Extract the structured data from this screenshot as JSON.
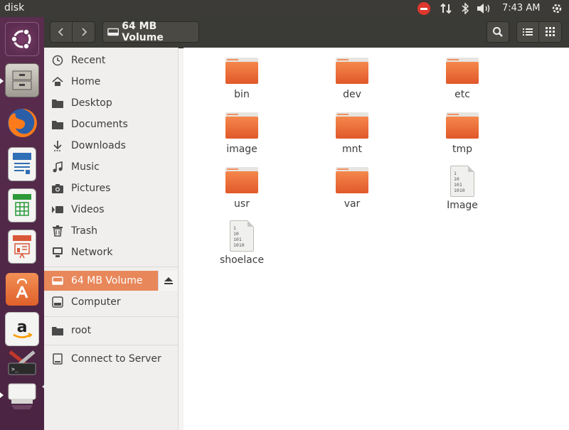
{
  "topbar": {
    "app_title": "disk",
    "clock": "7:43 AM"
  },
  "launcher": {
    "items": [
      {
        "icon": "ubuntu-dash-icon",
        "color": "#e95420"
      },
      {
        "icon": "file-cabinet-icon",
        "color": "#b9b6ae"
      },
      {
        "icon": "firefox-icon",
        "color": "#ff7a1a"
      },
      {
        "icon": "writer-document-icon",
        "color": "#2f6fb5"
      },
      {
        "icon": "calc-spreadsheet-icon",
        "color": "#2c9a3a"
      },
      {
        "icon": "impress-presentation-icon",
        "color": "#d9583a"
      },
      {
        "icon": "software-center-icon",
        "color": "#ef7634"
      },
      {
        "icon": "amazon-icon",
        "color": "#232f3e"
      },
      {
        "icon": "system-tools-icon",
        "color": "#c0c0c0"
      },
      {
        "icon": "removable-drive-icon",
        "color": "#e2e2e0"
      }
    ]
  },
  "headerbar": {
    "path_label": "64 MB Volume"
  },
  "sidebar": {
    "items": [
      {
        "label": "Recent",
        "icon": "clock-icon"
      },
      {
        "label": "Home",
        "icon": "home-icon"
      },
      {
        "label": "Desktop",
        "icon": "folder-icon"
      },
      {
        "label": "Documents",
        "icon": "folder-icon"
      },
      {
        "label": "Downloads",
        "icon": "download-icon"
      },
      {
        "label": "Music",
        "icon": "music-icon"
      },
      {
        "label": "Pictures",
        "icon": "camera-icon"
      },
      {
        "label": "Videos",
        "icon": "video-icon"
      },
      {
        "label": "Trash",
        "icon": "trash-icon"
      },
      {
        "label": "Network",
        "icon": "network-icon"
      }
    ],
    "devices": [
      {
        "label": "64 MB Volume",
        "icon": "drive-icon",
        "active": true
      },
      {
        "label": "Computer",
        "icon": "computer-icon"
      }
    ],
    "bookmarks": [
      {
        "label": "root",
        "icon": "folder-icon"
      }
    ],
    "connect": {
      "label": "Connect to Server",
      "icon": "server-icon"
    }
  },
  "files": [
    {
      "name": "bin",
      "type": "folder"
    },
    {
      "name": "dev",
      "type": "folder"
    },
    {
      "name": "etc",
      "type": "folder"
    },
    {
      "name": "image",
      "type": "folder"
    },
    {
      "name": "mnt",
      "type": "folder"
    },
    {
      "name": "tmp",
      "type": "folder"
    },
    {
      "name": "usr",
      "type": "folder"
    },
    {
      "name": "var",
      "type": "folder"
    },
    {
      "name": "Image",
      "type": "binary",
      "glyph": "1\n10\n101\n1010"
    },
    {
      "name": "shoelace",
      "type": "binary",
      "glyph": "1\n10\n101\n1010"
    }
  ],
  "colors": {
    "accent": "#e8875a",
    "folder": "#ec6a34",
    "launcher": "#5b2d4f",
    "panel": "#3c3b37"
  }
}
